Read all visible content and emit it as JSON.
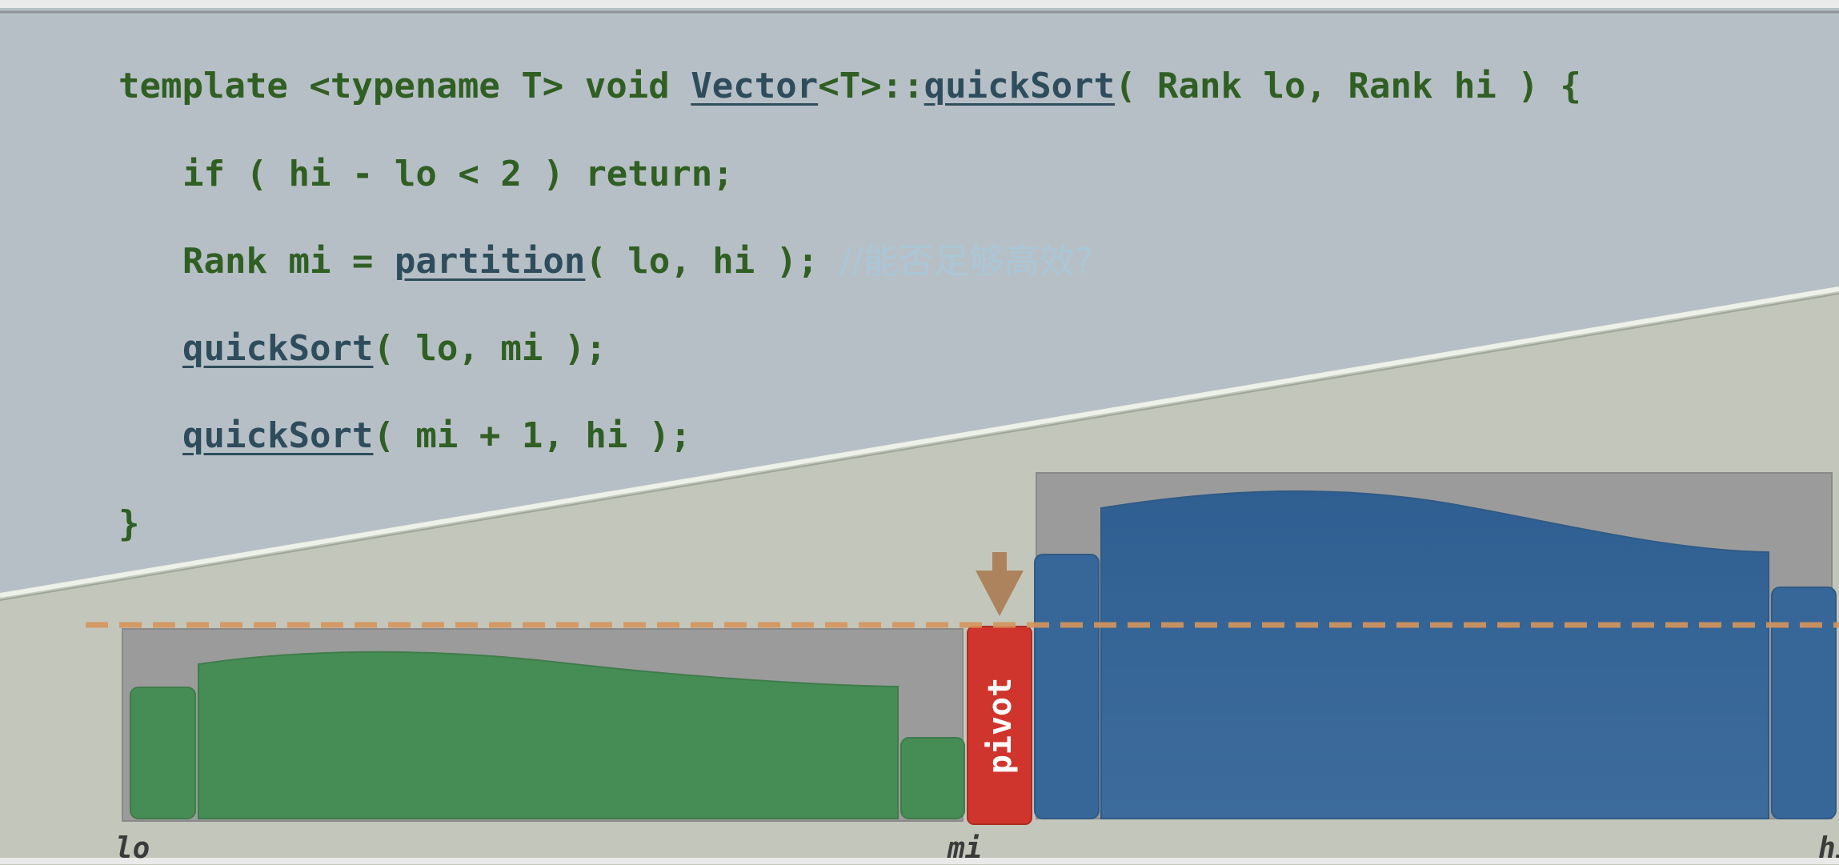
{
  "code": {
    "line1": {
      "prefix": "template <typename T> void ",
      "class_name": "Vector",
      "middle": "<T>::",
      "method": "quickSort",
      "suffix": "( Rank lo, Rank hi ) {"
    },
    "line2": "if ( hi - lo < 2 ) return;",
    "line3": {
      "prefix": "Rank mi = ",
      "call": "partition",
      "suffix": "( lo, hi ); ",
      "comment": "//能否足够高效?"
    },
    "line4": {
      "call": "quickSort",
      "suffix": "( lo, mi );"
    },
    "line5": {
      "call": "quickSort",
      "suffix": "( mi + 1, hi );"
    },
    "line6": "}"
  },
  "diagram": {
    "pivot_label": "pivot",
    "labels": {
      "lo": "lo",
      "mi": "mi",
      "hi": "hi"
    }
  },
  "colors": {
    "code_green": "#2f5f22",
    "function_blue": "#2e4d5c",
    "comment": "#a9c7d6",
    "upper_background": "#b7bfc6",
    "lower_background": "#c3c7bb",
    "left_partition": "#468d55",
    "right_partition": "#376799",
    "pivot": "#d0352d",
    "arrow": "#ad835d",
    "dashed_line": "#d6955c"
  }
}
